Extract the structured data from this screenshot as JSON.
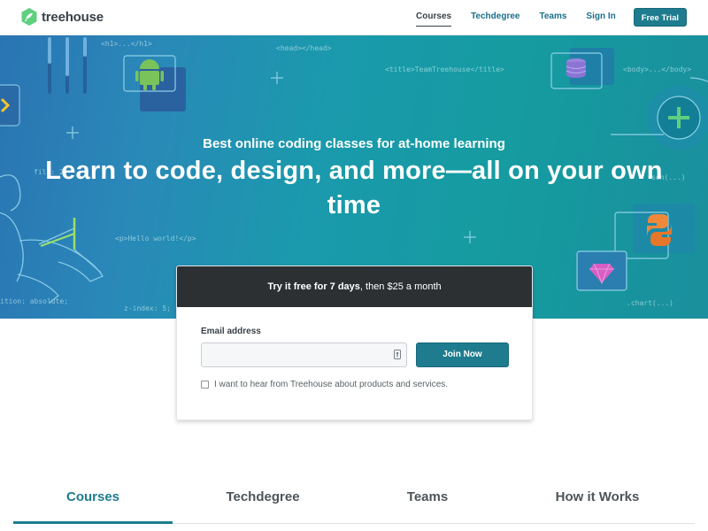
{
  "brand": {
    "name": "treehouse",
    "logo_icon": "treehouse-leaf-icon",
    "brand_color": "#5fcf80"
  },
  "nav": {
    "links": [
      "Courses",
      "Techdegree",
      "Teams",
      "Sign In"
    ],
    "active": "Courses",
    "cta_label": "Free Trial"
  },
  "hero": {
    "subtitle": "Best online coding classes for at-home learning",
    "title": "Learn to code, design, and more—all on your own time",
    "code_snippets": [
      "<h1>...</h1>",
      "<head></head>",
      "<title>TeamTreehouse</title>",
      "<body>...</body>",
      "<p>Hello world!</p>",
      "z-index: 5;",
      ".chart(...)",
      "fill: 2",
      "ition: absolute;",
      "son(...)"
    ],
    "icons": [
      "android-icon",
      "database-icon",
      "plus-icon",
      "python-icon",
      "ruby-gem-icon",
      "chevron-right-icon",
      "person-with-laptop-illustration"
    ]
  },
  "signup": {
    "header_bold": "Try it free for 7 days",
    "header_rest": ", then $25 a month",
    "email_label": "Email address",
    "email_value": "",
    "email_placeholder": "",
    "submit_label": "Join Now",
    "optin_label": "I want to hear from Treehouse about products and services.",
    "optin_checked": false
  },
  "tabs": {
    "items": [
      "Courses",
      "Techdegree",
      "Teams",
      "How it Works"
    ],
    "active": "Courses"
  },
  "colors": {
    "accent": "#1e7c8e",
    "card_header": "#2d3033",
    "hero_start": "#2a74b3",
    "hero_end": "#159ba0"
  }
}
